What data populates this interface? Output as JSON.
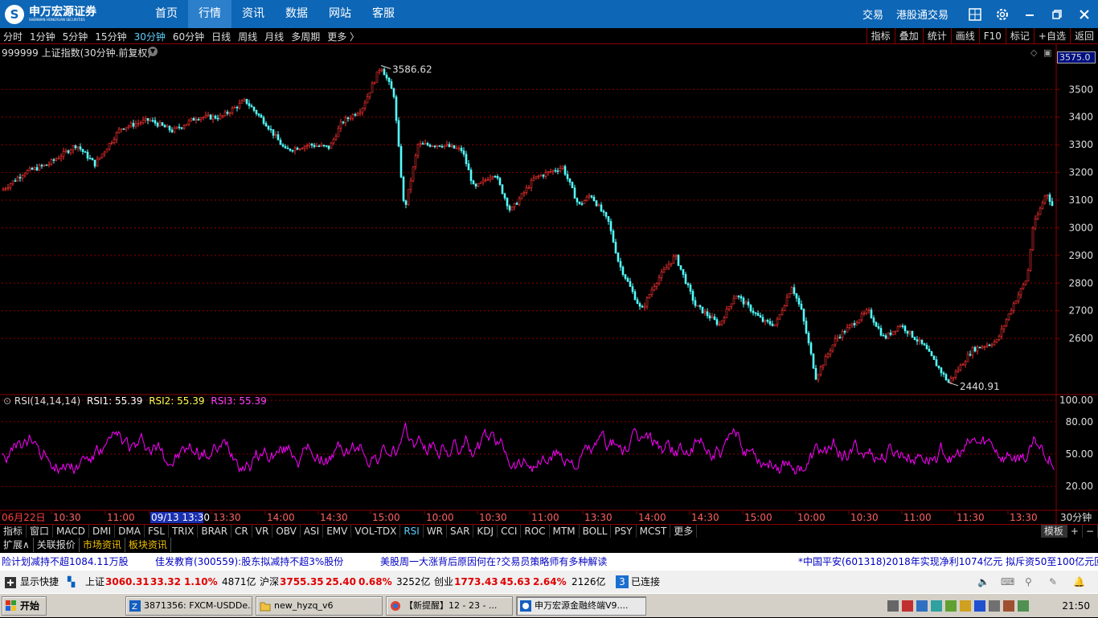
{
  "titlebar": {
    "logo_text": "申万宏源证券",
    "logo_sub": "SHENWAN HONGYUAN SECURITIES",
    "nav": [
      "首页",
      "行情",
      "资讯",
      "数据",
      "网站",
      "客服"
    ],
    "nav_active": 1,
    "right_links": [
      "交易",
      "港股通交易"
    ],
    "icons": [
      "grid-icon",
      "gear-icon",
      "minimize-icon",
      "restore-icon",
      "close-icon"
    ]
  },
  "toolbar": {
    "periods": [
      "分时",
      "1分钟",
      "5分钟",
      "15分钟",
      "30分钟",
      "60分钟",
      "日线",
      "周线",
      "月线",
      "多周期",
      "更多 〉"
    ],
    "active_period": 4,
    "right_buttons": [
      "指标",
      "叠加",
      "统计",
      "画线",
      "F10",
      "标记",
      "+自选",
      "返回"
    ]
  },
  "chart": {
    "symbol_title": "999999 上证指数(30分钟.前复权)",
    "price_flag": "3575.0",
    "high_label": "3586.62",
    "low_label": "2440.91",
    "price_axis": [
      "3500",
      "3400",
      "3300",
      "3200",
      "3100",
      "3000",
      "2900",
      "2800",
      "2700",
      "2600"
    ],
    "rsi_title": "RSI(14,14,14)",
    "rsi1_label": "RSI1: 55.39",
    "rsi2_label": "RSI2: 55.39",
    "rsi3_label": "RSI3: 55.39",
    "rsi_axis": [
      "100.00",
      "80.00",
      "50.00",
      "20.00"
    ],
    "time_labels": [
      "06月22日",
      "10:30",
      "11:00",
      "09/13 13:30",
      "13:30",
      "14:00",
      "14:30",
      "15:00",
      "10:00",
      "10:30",
      "11:00",
      "13:30",
      "14:00",
      "14:30",
      "15:00",
      "10:00",
      "10:30",
      "11:00",
      "11:30",
      "13:30"
    ],
    "period_label": "30分钟",
    "colors": {
      "up": "#ff3232",
      "down": "#54ffff",
      "rsi": "#ff00ff",
      "grid": "#8b0000"
    }
  },
  "chart_data": {
    "type": "candlestick",
    "title": "999999 上证指数(30分钟.前复权)",
    "ylim": [
      2400,
      3620
    ],
    "anchors": [
      [
        0,
        3130
      ],
      [
        30,
        3200
      ],
      [
        60,
        3230
      ],
      [
        95,
        3300
      ],
      [
        118,
        3230
      ],
      [
        150,
        3360
      ],
      [
        185,
        3390
      ],
      [
        215,
        3350
      ],
      [
        245,
        3400
      ],
      [
        275,
        3400
      ],
      [
        305,
        3460
      ],
      [
        330,
        3380
      ],
      [
        355,
        3280
      ],
      [
        385,
        3300
      ],
      [
        410,
        3290
      ],
      [
        425,
        3380
      ],
      [
        450,
        3430
      ],
      [
        474,
        3586.62
      ],
      [
        490,
        3480
      ],
      [
        503,
        3060
      ],
      [
        520,
        3300
      ],
      [
        550,
        3300
      ],
      [
        575,
        3280
      ],
      [
        590,
        3140
      ],
      [
        615,
        3200
      ],
      [
        635,
        3060
      ],
      [
        665,
        3180
      ],
      [
        700,
        3220
      ],
      [
        720,
        3080
      ],
      [
        735,
        3120
      ],
      [
        757,
        3020
      ],
      [
        770,
        2870
      ],
      [
        798,
        2700
      ],
      [
        815,
        2800
      ],
      [
        840,
        2900
      ],
      [
        865,
        2720
      ],
      [
        895,
        2650
      ],
      [
        915,
        2760
      ],
      [
        950,
        2660
      ],
      [
        965,
        2650
      ],
      [
        985,
        2790
      ],
      [
        997,
        2700
      ],
      [
        1015,
        2460
      ],
      [
        1040,
        2600
      ],
      [
        1080,
        2700
      ],
      [
        1100,
        2600
      ],
      [
        1120,
        2650
      ],
      [
        1150,
        2570
      ],
      [
        1180,
        2440.91
      ],
      [
        1210,
        2560
      ],
      [
        1240,
        2590
      ],
      [
        1260,
        2720
      ],
      [
        1278,
        2820
      ],
      [
        1285,
        3000
      ],
      [
        1302,
        3130
      ],
      [
        1312,
        3060
      ]
    ],
    "rsi": {
      "title": "RSI(14,14,14)",
      "rsi1": 55.39,
      "rsi2": 55.39,
      "rsi3": 55.39,
      "ylim": [
        0,
        100
      ]
    }
  },
  "tabs": {
    "items": [
      "指标",
      "窗口",
      "MACD",
      "DMI",
      "DMA",
      "FSL",
      "TRIX",
      "BRAR",
      "CR",
      "VR",
      "OBV",
      "ASI",
      "EMV",
      "VOL-TDX",
      "RSI",
      "WR",
      "SAR",
      "KDJ",
      "CCI",
      "ROC",
      "MTM",
      "BOLL",
      "PSY",
      "MCST",
      "更多"
    ],
    "active": 14,
    "right": [
      "模板",
      "+",
      "−"
    ]
  },
  "ext_tabs": {
    "items": [
      "扩展∧",
      "关联报价",
      "市场资讯",
      "板块资讯"
    ],
    "active": [
      2,
      3
    ]
  },
  "ticker": {
    "items": [
      "险计划减持不超1084.11万股",
      "佳发教育(300559):股东拟减持不超3%股份",
      "美股周一大涨背后原因何在?交易员策略师有多种解读",
      "*中国平安(601318)2018年实现净利1074亿元  拟斥资50至100亿元回购A"
    ]
  },
  "statusbar": {
    "show_shortcut": "显示快捷",
    "sh_name": "上证",
    "sh_price": "3060.31",
    "sh_change": "33.32",
    "sh_pct": "1.10%",
    "sh_vol": "4871亿",
    "hs_name": "沪深",
    "hs_price": "3755.35",
    "hs_change": "25.40",
    "hs_pct": "0.68%",
    "hs_vol": "3252亿",
    "cy_name": "创业",
    "cy_price": "1773.43",
    "cy_change": "45.63",
    "cy_pct": "2.64%",
    "cy_vol": "2126亿",
    "conn_count": "3",
    "conn_text": "已连接"
  },
  "taskbar": {
    "start": "开始",
    "tasks": [
      "3871356: FXCM-USDDe...",
      "new_hyzq_v6",
      "【新提醒】12 - 23 - ...",
      "申万宏源金融终端V9...."
    ],
    "clock": "21:50"
  }
}
